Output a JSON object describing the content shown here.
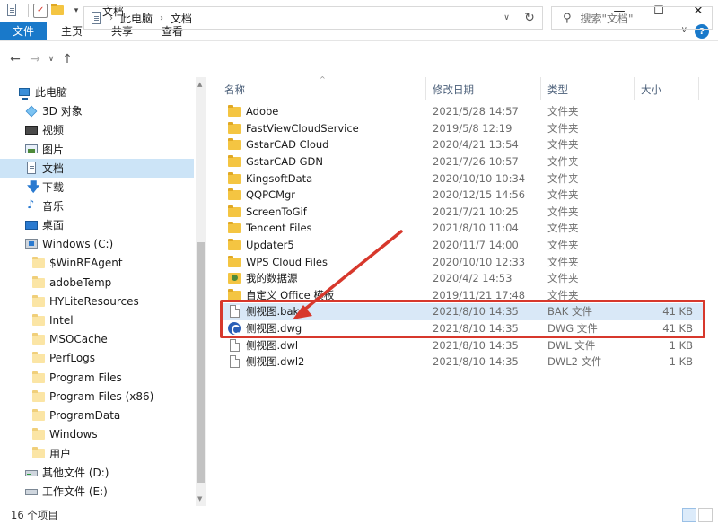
{
  "window": {
    "title": "文档",
    "controls": {
      "minimize": "—",
      "maximize": "☐",
      "close": "✕"
    }
  },
  "ribbon": {
    "tabs": [
      "文件",
      "主页",
      "共享",
      "查看"
    ],
    "help": "?",
    "expand": "∨"
  },
  "nav": {
    "back": "←",
    "forward": "→",
    "recent": "∨",
    "up": "↑",
    "breadcrumb": [
      "此电脑",
      "文档"
    ],
    "refresh": "↻",
    "search_placeholder": "搜索\"文档\""
  },
  "sidebar": {
    "items": [
      {
        "label": "此电脑",
        "icon": "pc-icon",
        "indent": 0
      },
      {
        "label": "3D 对象",
        "icon": "3d-objects-icon",
        "indent": 1
      },
      {
        "label": "视频",
        "icon": "video-icon",
        "indent": 1
      },
      {
        "label": "图片",
        "icon": "pictures-icon",
        "indent": 1
      },
      {
        "label": "文档",
        "icon": "documents-icon",
        "indent": 1,
        "selected": true
      },
      {
        "label": "下载",
        "icon": "download-icon",
        "indent": 1
      },
      {
        "label": "音乐",
        "icon": "music-icon",
        "indent": 1
      },
      {
        "label": "桌面",
        "icon": "desktop-icon",
        "indent": 1
      },
      {
        "label": "Windows (C:)",
        "icon": "drive-c-icon",
        "indent": 1
      },
      {
        "label": "$WinREAgent",
        "icon": "folder-icon",
        "indent": 2
      },
      {
        "label": "adobeTemp",
        "icon": "folder-icon",
        "indent": 2
      },
      {
        "label": "HYLiteResources",
        "icon": "folder-icon",
        "indent": 2
      },
      {
        "label": "Intel",
        "icon": "folder-icon",
        "indent": 2
      },
      {
        "label": "MSOCache",
        "icon": "folder-icon",
        "indent": 2
      },
      {
        "label": "PerfLogs",
        "icon": "folder-icon",
        "indent": 2
      },
      {
        "label": "Program Files",
        "icon": "folder-icon",
        "indent": 2
      },
      {
        "label": "Program Files (x86)",
        "icon": "folder-icon",
        "indent": 2
      },
      {
        "label": "ProgramData",
        "icon": "folder-icon",
        "indent": 2
      },
      {
        "label": "Windows",
        "icon": "folder-icon",
        "indent": 2
      },
      {
        "label": "用户",
        "icon": "folder-icon",
        "indent": 2
      },
      {
        "label": "其他文件 (D:)",
        "icon": "drive-icon",
        "indent": 1
      },
      {
        "label": "工作文件 (E:)",
        "icon": "drive-icon",
        "indent": 1
      }
    ]
  },
  "list": {
    "columns": {
      "name": "名称",
      "date": "修改日期",
      "type": "类型",
      "size": "大小"
    },
    "rows": [
      {
        "name": "Adobe",
        "date": "2021/5/28 14:57",
        "type": "文件夹",
        "size": "",
        "icon": "folder-icon"
      },
      {
        "name": "FastViewCloudService",
        "date": "2019/5/8 12:19",
        "type": "文件夹",
        "size": "",
        "icon": "folder-icon"
      },
      {
        "name": "GstarCAD Cloud",
        "date": "2020/4/21 13:54",
        "type": "文件夹",
        "size": "",
        "icon": "folder-icon"
      },
      {
        "name": "GstarCAD GDN",
        "date": "2021/7/26 10:57",
        "type": "文件夹",
        "size": "",
        "icon": "folder-icon"
      },
      {
        "name": "KingsoftData",
        "date": "2020/10/10 10:34",
        "type": "文件夹",
        "size": "",
        "icon": "folder-icon"
      },
      {
        "name": "QQPCMgr",
        "date": "2020/12/15 14:56",
        "type": "文件夹",
        "size": "",
        "icon": "folder-icon"
      },
      {
        "name": "ScreenToGif",
        "date": "2021/7/21 10:25",
        "type": "文件夹",
        "size": "",
        "icon": "folder-icon"
      },
      {
        "name": "Tencent Files",
        "date": "2021/8/10 11:04",
        "type": "文件夹",
        "size": "",
        "icon": "folder-icon"
      },
      {
        "name": "Updater5",
        "date": "2020/11/7 14:00",
        "type": "文件夹",
        "size": "",
        "icon": "folder-icon"
      },
      {
        "name": "WPS Cloud Files",
        "date": "2020/10/10 12:33",
        "type": "文件夹",
        "size": "",
        "icon": "folder-icon"
      },
      {
        "name": "我的数据源",
        "date": "2020/4/2 14:53",
        "type": "文件夹",
        "size": "",
        "icon": "data-source-icon"
      },
      {
        "name": "自定义 Office 模板",
        "date": "2019/11/21 17:48",
        "type": "文件夹",
        "size": "",
        "icon": "folder-icon"
      },
      {
        "name": "侧视图.bak",
        "date": "2021/8/10 14:35",
        "type": "BAK 文件",
        "size": "41 KB",
        "icon": "file-icon",
        "highlight": true
      },
      {
        "name": "侧视图.dwg",
        "date": "2021/8/10 14:35",
        "type": "DWG 文件",
        "size": "41 KB",
        "icon": "dwg-icon"
      },
      {
        "name": "侧视图.dwl",
        "date": "2021/8/10 14:35",
        "type": "DWL 文件",
        "size": "1 KB",
        "icon": "file-icon"
      },
      {
        "name": "侧视图.dwl2",
        "date": "2021/8/10 14:35",
        "type": "DWL2 文件",
        "size": "1 KB",
        "icon": "file-icon"
      }
    ]
  },
  "status": {
    "count": "16 个项目"
  },
  "colors": {
    "accent": "#1979ca",
    "selection": "#cce4f7",
    "annotation": "#d7382c"
  }
}
